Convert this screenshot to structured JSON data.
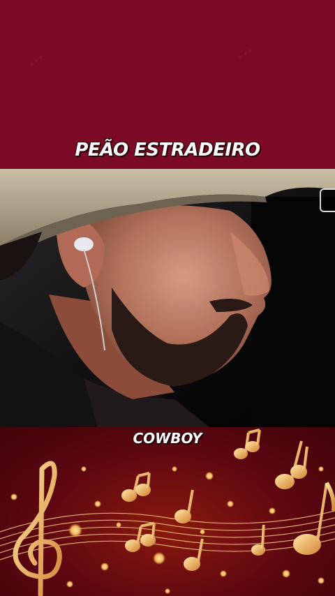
{
  "header": {
    "title": "PEÃO ESTRADEIRO"
  },
  "caption": {
    "text": "COWBOY"
  },
  "video": {
    "description_icon": "video-frame"
  },
  "colors": {
    "top_panel": "#7a0a26",
    "music_gold": "#f3b35a",
    "caption_text": "#ffffff"
  },
  "decoration": {
    "icon": "music-notes-icon"
  }
}
